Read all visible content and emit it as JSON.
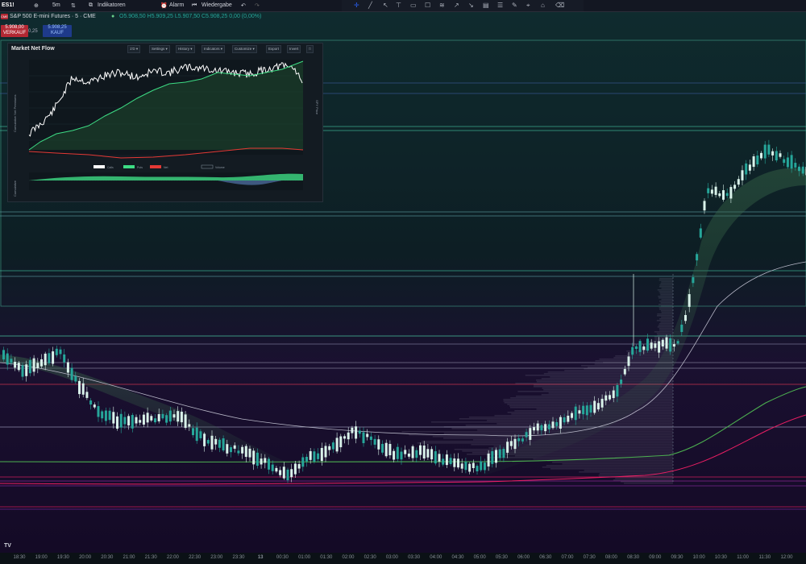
{
  "topbar": {
    "symbol": "ES1!",
    "interval": "5m",
    "indicators": "Indikatoren",
    "alarm": "Alarm",
    "replay": "Wiedergabe",
    "undo_icon": "undo-icon",
    "redo_icon": "redo-icon"
  },
  "drawing_tools": [
    "crosshair-icon",
    "trendline-icon",
    "arrow-icon",
    "rectangle-icon",
    "square-icon",
    "fib-icon",
    "arrow-diag-icon",
    "measure-icon",
    "ruler-icon",
    "brush-icon",
    "pin-icon",
    "note-icon",
    "eraser-icon"
  ],
  "symbol_info": {
    "logo": "CME",
    "title": "S&P 500 E-mini Futures · 5 · CME",
    "ohlc": "O5.908,50 H5.909,25 L5.907,50 C5.908,25 0,00 (0,00%)"
  },
  "trade": {
    "sell_price": "5.908,00",
    "sell_label": "VERKAUF",
    "spread": "0,25",
    "buy_price": "5.908,25",
    "buy_label": "KAUF"
  },
  "panel": {
    "title": "Market Net Flow",
    "buttons": [
      "1'D ▾",
      "Settings ▾",
      "History ▾",
      "Indicators ▾",
      "Customize ▾",
      "Export",
      "Invert",
      "□"
    ],
    "y_left_title": "Cumulative Net Premiums",
    "y_right_title": "SPY Price",
    "sub_y_title": "Cumulative",
    "legend": [
      "Calls",
      "Puts",
      "Net",
      "Volume"
    ]
  },
  "xaxis": [
    "18:30",
    "19:00",
    "19:30",
    "20:00",
    "20:30",
    "21:00",
    "21:30",
    "22:00",
    "22:30",
    "23:00",
    "23:30",
    "13",
    "00:30",
    "01:00",
    "01:30",
    "02:00",
    "02:30",
    "03:00",
    "03:30",
    "04:00",
    "04:30",
    "05:00",
    "05:30",
    "06:00",
    "06:30",
    "07:00",
    "07:30",
    "08:00",
    "08:30",
    "09:00",
    "09:30",
    "10:00",
    "10:30",
    "11:00",
    "11:30",
    "12:00"
  ],
  "logo_text": "TV",
  "colors": {
    "up": "#d9f2ea",
    "down": "#26a69a",
    "sell": "#b22833",
    "buy": "#1e3a8a",
    "green_line": "#4caf50",
    "pink_line": "#e91e63",
    "active_tool": "#2962ff"
  }
}
